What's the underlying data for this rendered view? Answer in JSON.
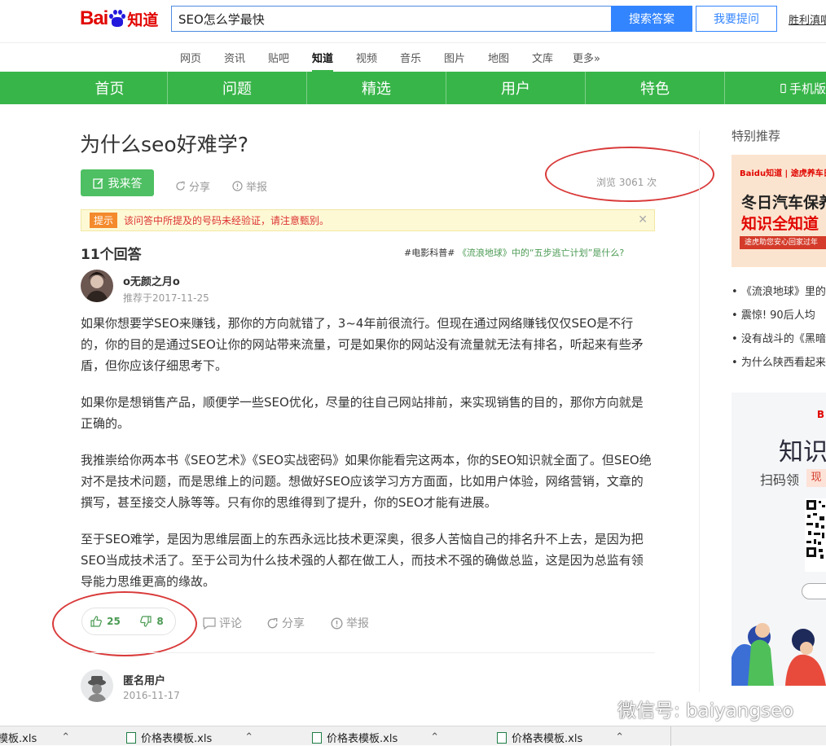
{
  "header": {
    "logo_text": "Baidu知道",
    "search_value": "SEO怎么学最快",
    "search_button": "搜索答案",
    "ask_button": "我要提问",
    "user": "胜利滇唱"
  },
  "subnav": [
    "网页",
    "资讯",
    "贴吧",
    "知道",
    "视频",
    "音乐",
    "图片",
    "地图",
    "文库",
    "更多»"
  ],
  "green_nav": [
    "首页",
    "问题",
    "精选",
    "用户",
    "特色",
    "手机版"
  ],
  "question": {
    "title": "为什么seo好难学?",
    "answer_button": "我来答",
    "share": "分享",
    "report": "举报",
    "views": "浏览 3061 次",
    "notice_tag": "提示",
    "notice_text": "该问答中所提及的号码未经验证，请注意甄别。"
  },
  "answers_header": {
    "count": "11个回答",
    "hot_tag": "#电影科普#",
    "hot_text": "《流浪地球》中的“五步逃亡计划”是什么?"
  },
  "answer": {
    "username": "o无颜之月o",
    "date": "推荐于2017-11-25",
    "paragraphs": [
      "如果你想要学SEO来赚钱，那你的方向就错了，3~4年前很流行。但现在通过网络赚钱仅仅SEO是不行的，你的目的是通过SEO让你的网站带来流量，可是如果你的网站没有流量就无法有排名，听起来有些矛盾，但你应该仔细思考下。",
      "如果你是想销售产品，顺便学一些SEO优化，尽量的往自己网站排前，来实现销售的目的，那你方向就是正确的。",
      "我推崇给你两本书《SEO艺术》《SEO实战密码》如果你能看完这两本，你的SEO知识就全面了。但SEO绝对不是技术问题，而是思维上的问题。想做好SEO应该学习方方面面，比如用户体验，网络营销，文章的撰写，甚至接交人脉等等。只有你的思维得到了提升，你的SEO才能有进展。",
      "至于SEO难学，是因为思维层面上的东西永远比技术更深奥，很多人苦恼自己的排名升不上去，是因为把SEO当成技术活了。至于公司为什么技术强的人都在做工人，而技术不强的确做总监，这是因为总监有领导能力思维更高的缘故。"
    ],
    "likes": "25",
    "dislikes": "8",
    "comment": "评论",
    "share": "分享",
    "report": "举报"
  },
  "answer2": {
    "username": "匿名用户",
    "date": "2016-11-17"
  },
  "sidebar": {
    "title": "特别推荐",
    "ad1_line1": "冬日汽车保养",
    "ad1_line2": "知识全知道",
    "ad1_brand": "途虎养车日",
    "ad1_small": "途虎助您安心回家过年",
    "links": [
      "《流浪地球》里的",
      "震惊! 90后人均",
      "没有战斗的《黑暗",
      "为什么陕西看起来"
    ],
    "ad2_title": "知识",
    "ad2_sub": "扫码领",
    "ad2_tag": "现"
  },
  "taskbar": [
    "价格表模板.xls",
    "价格表模板.xls",
    "价格表模板.xls",
    "价格表模板.xls"
  ],
  "watermark": "微信号: baiyangseo",
  "colors": {
    "green": "#38b549",
    "blue": "#3385ff",
    "red_circle": "#d93a3a"
  }
}
